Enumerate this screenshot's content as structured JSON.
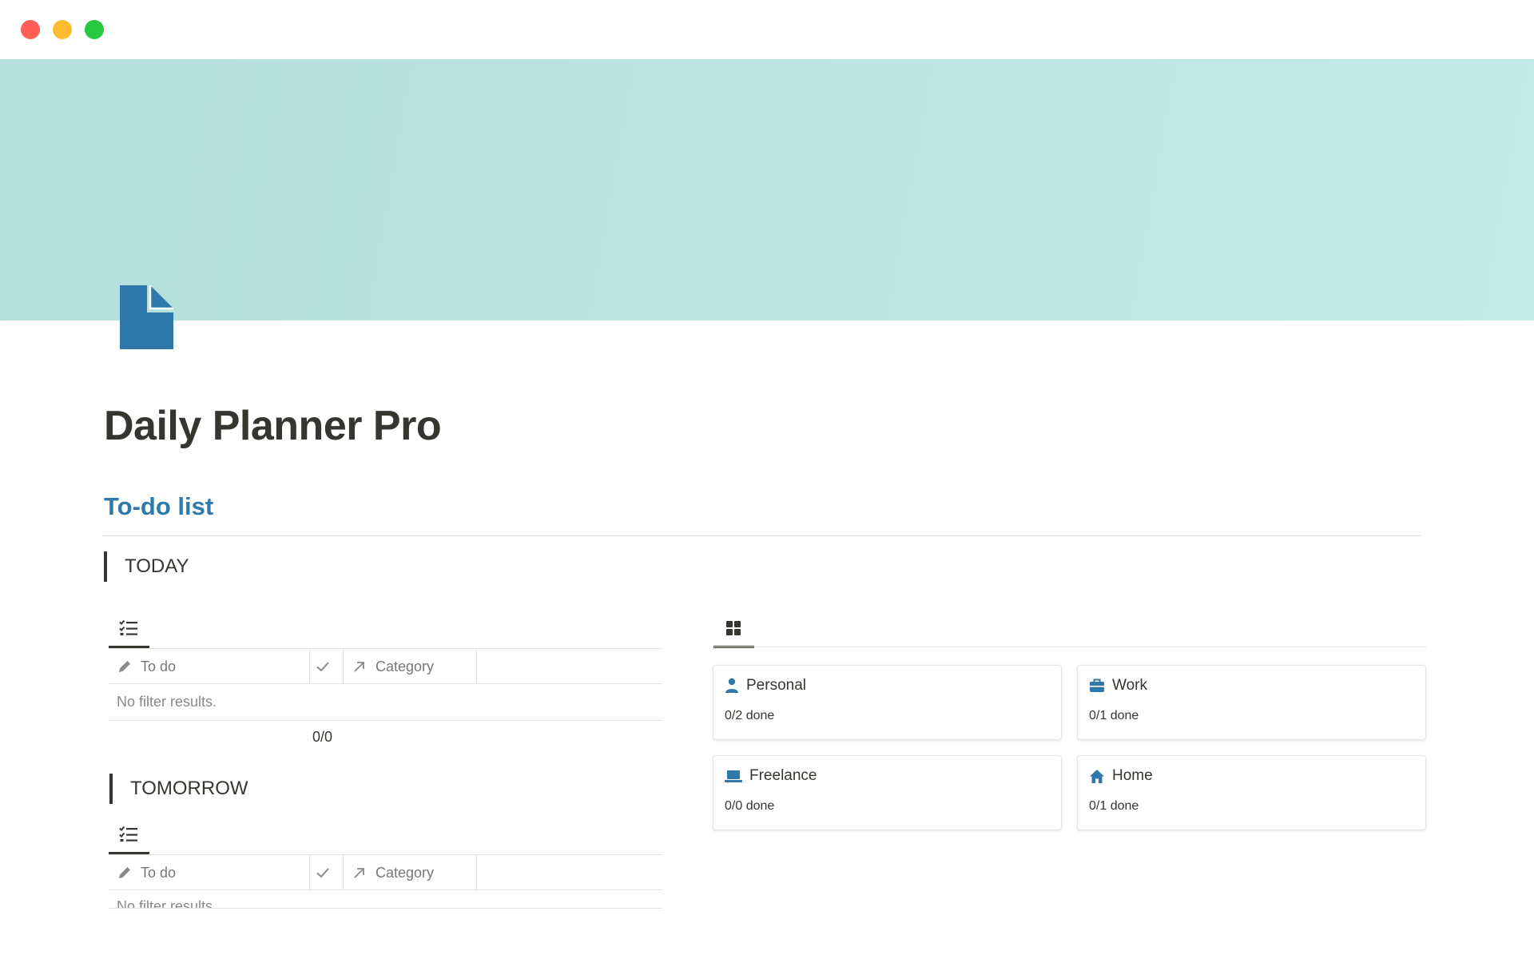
{
  "window": {
    "controls": [
      "close",
      "minimize",
      "maximize"
    ]
  },
  "page": {
    "icon": "document-icon",
    "title": "Daily Planner Pro",
    "cover_color": "#b8e2e0",
    "accent_color": "#2e7aab"
  },
  "todo_section": {
    "heading": "To-do list"
  },
  "today": {
    "heading": "TODAY",
    "view_icon": "checklist-icon",
    "columns": {
      "todo": "To do",
      "check_icon": "checkmark-icon",
      "category": "Category"
    },
    "empty_text": "No filter results.",
    "count": "0/0"
  },
  "tomorrow": {
    "heading": "TOMORROW",
    "view_icon": "checklist-icon",
    "columns": {
      "todo": "To do",
      "check_icon": "checkmark-icon",
      "category": "Category"
    },
    "empty_text": "No filter results."
  },
  "gallery": {
    "view_icon": "grid-icon",
    "cards": [
      {
        "title": "Personal",
        "icon": "person-icon",
        "progress": "0/2 done"
      },
      {
        "title": "Work",
        "icon": "briefcase-icon",
        "progress": "0/1 done"
      },
      {
        "title": "Freelance",
        "icon": "laptop-icon",
        "progress": "0/0 done"
      },
      {
        "title": "Home",
        "icon": "house-icon",
        "progress": "0/1 done"
      }
    ]
  }
}
